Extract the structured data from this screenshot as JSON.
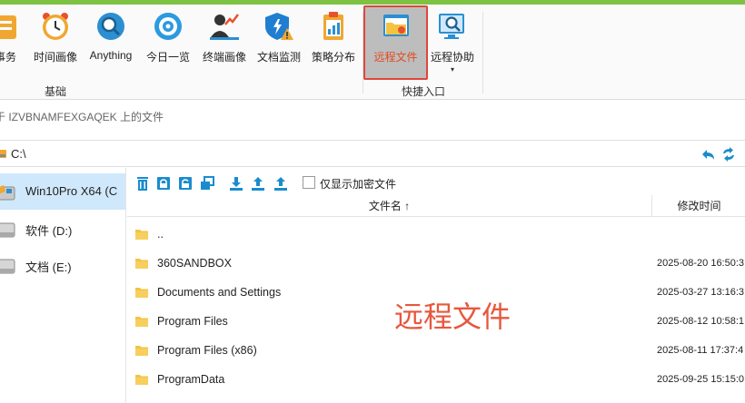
{
  "ribbon": {
    "buttons": [
      {
        "label": "事务",
        "icon": "task-icon"
      },
      {
        "label": "时间画像",
        "icon": "clock-icon"
      },
      {
        "label": "Anything",
        "icon": "search-globe-icon"
      },
      {
        "label": "今日一览",
        "icon": "eye-target-icon"
      },
      {
        "label": "终端画像",
        "icon": "user-chart-icon"
      },
      {
        "label": "文档监测",
        "icon": "shield-warning-icon"
      },
      {
        "label": "策略分布",
        "icon": "clipboard-chart-icon"
      },
      {
        "label": "远程文件",
        "icon": "remote-folder-icon"
      },
      {
        "label": "远程协助",
        "icon": "monitor-search-icon"
      }
    ],
    "dropdown_arrow": "▾",
    "groups": [
      {
        "label": "基础"
      },
      {
        "label": "快捷入口"
      }
    ]
  },
  "window_title": "于 IZVBNAMFEXGAQEK 上的文件",
  "path": {
    "value": "C:\\"
  },
  "sidebar": {
    "items": [
      {
        "label": "Win10Pro X64 (C"
      },
      {
        "label": "软件 (D:)"
      },
      {
        "label": "文档 (E:)"
      }
    ]
  },
  "toolbar": {
    "checkbox_label": "仅显示加密文件"
  },
  "table": {
    "columns": {
      "name": "文件名 ↑",
      "time": "修改时间"
    },
    "rows": [
      {
        "name": "..",
        "time": ""
      },
      {
        "name": "360SANDBOX",
        "time": "2025-08-20 16:50:3"
      },
      {
        "name": "Documents and Settings",
        "time": "2025-03-27 13:16:3"
      },
      {
        "name": "Program Files",
        "time": "2025-08-12 10:58:1"
      },
      {
        "name": "Program Files (x86)",
        "time": "2025-08-11 17:37:4"
      },
      {
        "name": "ProgramData",
        "time": "2025-09-25 15:15:0"
      }
    ]
  },
  "watermark": "远程文件",
  "colors": {
    "accent": "#1a8ccd",
    "highlight": "#e0463c",
    "folder": "#f5c342",
    "topbar": "#7dc243"
  }
}
